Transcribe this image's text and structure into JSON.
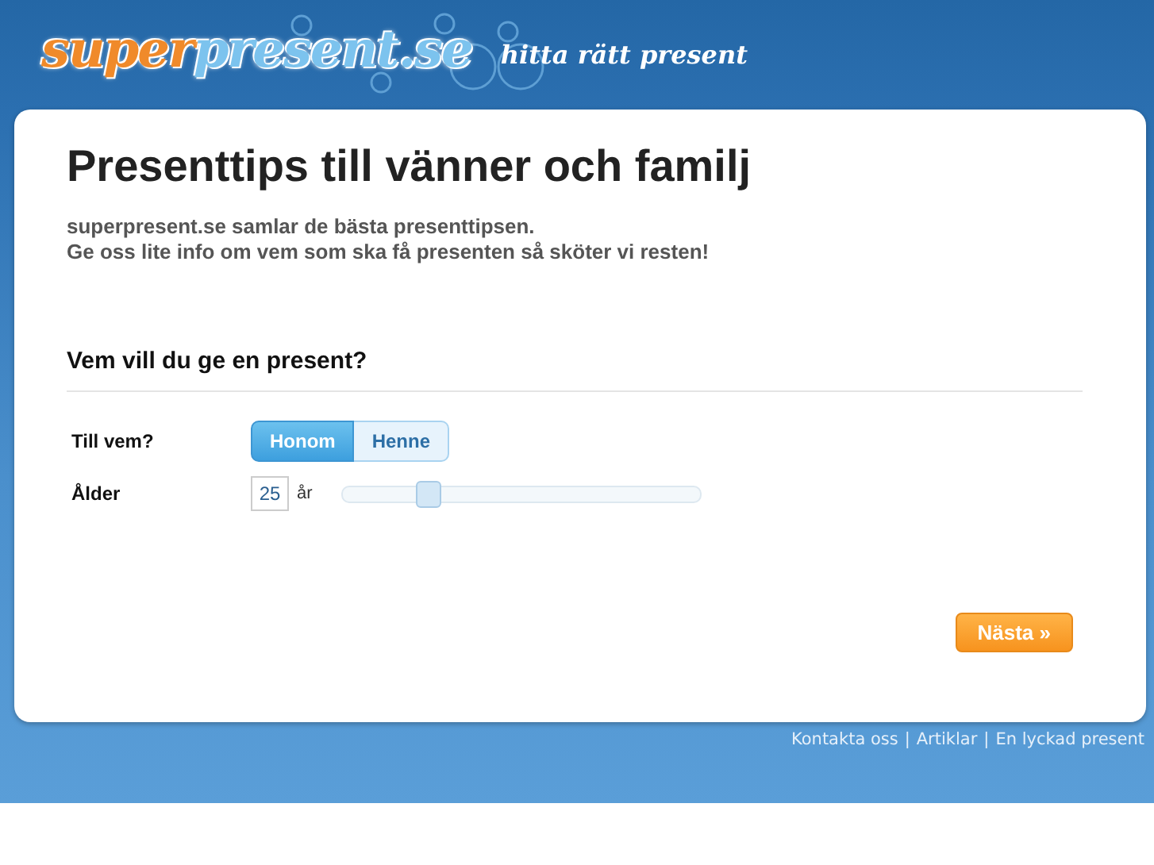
{
  "header": {
    "logo_parts": [
      {
        "text": "super",
        "color": "#f08a2a"
      },
      {
        "text": "present.se",
        "color": "#7cc3ee"
      }
    ],
    "tagline": "hitta rätt present"
  },
  "title": "Presenttips till vänner och familj",
  "intro": [
    "superpresent.se samlar de bästa presenttipsen.",
    "Ge oss lite info om vem som ska få presenten så sköter vi resten!"
  ],
  "section_title": "Vem vill du ge en present?",
  "recipient": {
    "label": "Till vem?",
    "options": [
      {
        "label": "Honom",
        "selected": true
      },
      {
        "label": "Henne",
        "selected": false
      }
    ]
  },
  "age": {
    "label": "Ålder",
    "value": "25",
    "unit": "år",
    "level": 0.24
  },
  "next_button": "Nästa »",
  "footer_links": [
    {
      "text": "Kontakta oss"
    },
    {
      "text": "|"
    },
    {
      "text": "Artiklar"
    },
    {
      "text": "|"
    },
    {
      "text": "En lyckad present"
    }
  ]
}
